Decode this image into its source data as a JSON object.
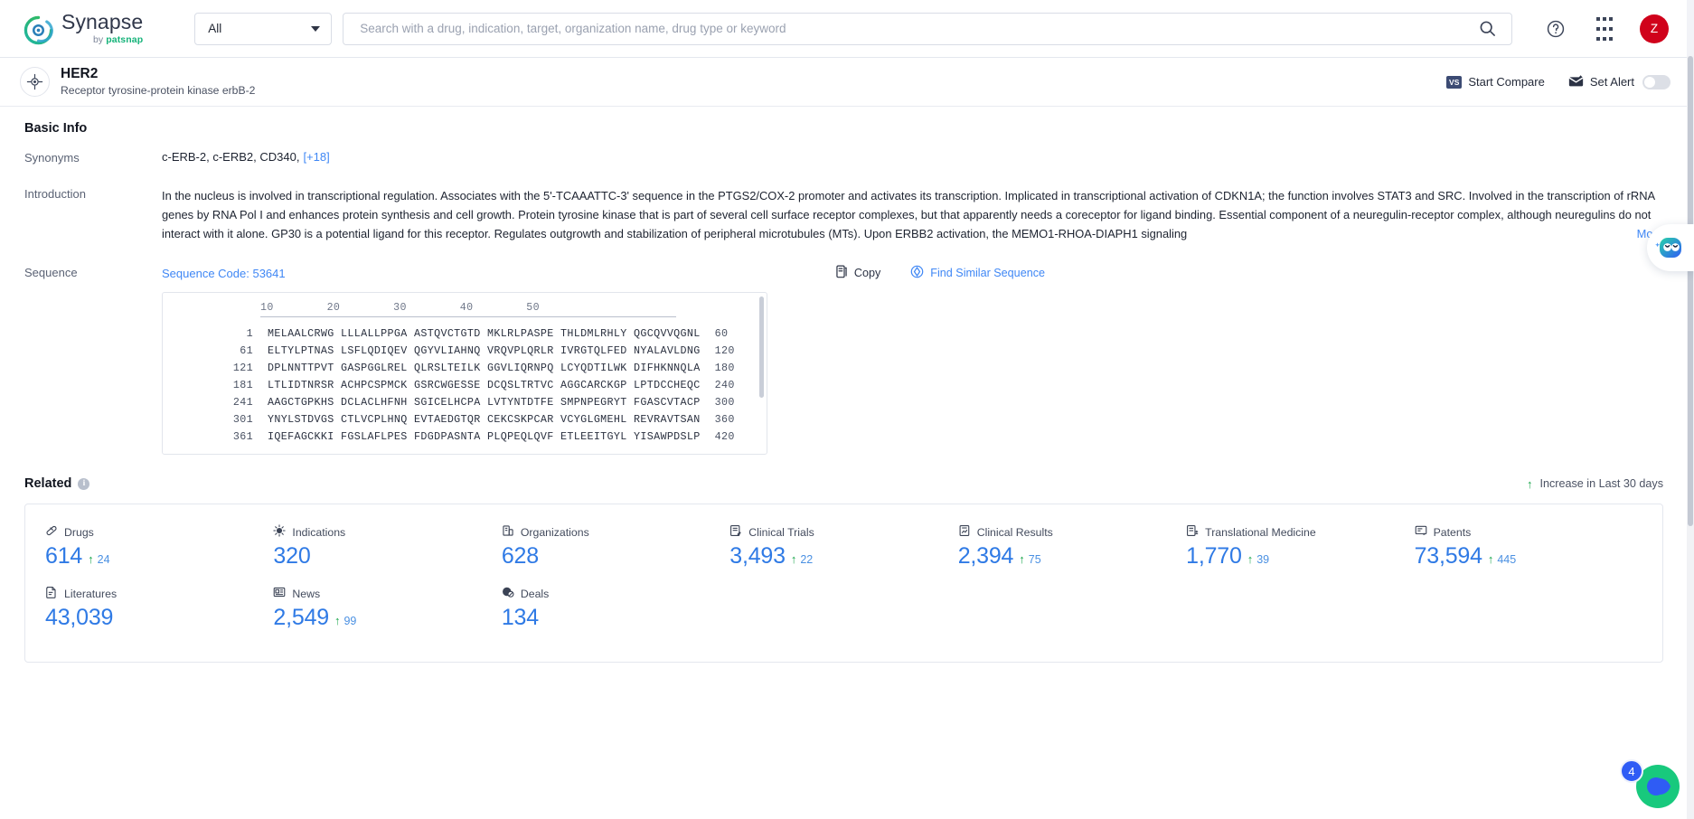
{
  "brand": {
    "name": "Synapse",
    "by": "by ",
    "by_brand": "patsnap",
    "logo_icon": "synapse-logo-icon"
  },
  "topbar": {
    "scope_selected": "All",
    "scope_caret_icon": "chevron-down-icon",
    "search_placeholder": "Search with a drug, indication, target, organization name, drug type or keyword",
    "search_value": "",
    "search_icon": "search-icon",
    "help_icon": "help-circle-icon",
    "apps_icon": "apps-grid-icon",
    "avatar_initial": "Z"
  },
  "entity": {
    "icon": "target-crosshair-icon",
    "name": "HER2",
    "description": "Receptor tyrosine-protein kinase erbB-2",
    "start_compare_label": "Start Compare",
    "start_compare_badge": "VS",
    "set_alert_label": "Set Alert",
    "set_alert_icon": "alert-envelope-icon",
    "set_alert_on": false
  },
  "basic_info": {
    "title": "Basic Info",
    "synonyms_label": "Synonyms",
    "synonyms_value": "c-ERB-2,  c-ERB2,  CD340,",
    "synonyms_more": "[+18]",
    "introduction_label": "Introduction",
    "introduction_text": "In the nucleus is involved in transcriptional regulation. Associates with the 5'-TCAAATTC-3' sequence in the PTGS2/COX-2 promoter and activates its transcription. Implicated in transcriptional activation of CDKN1A; the function involves STAT3 and SRC. Involved in the transcription of rRNA genes by RNA Pol I and enhances protein synthesis and cell growth. Protein tyrosine kinase that is part of several cell surface receptor complexes, but that apparently needs a coreceptor for ligand binding. Essential component of a neuregulin-receptor complex, although neuregulins do not interact with it alone. GP30 is a potential ligand for this receptor. Regulates outgrowth and stabilization of peripheral microtubules (MTs). Upon ERBB2 activation, the MEMO1-RHOA-DIAPH1 signaling",
    "introduction_more": "More",
    "sequence_label": "Sequence",
    "sequence_code": "Sequence Code: 53641",
    "copy_label": "Copy",
    "copy_icon": "copy-icon",
    "find_similar_label": "Find Similar Sequence",
    "find_similar_icon": "find-similar-sequence-icon",
    "sequence_ruler": "10        20        30        40        50",
    "sequence_rows": [
      {
        "start": "1",
        "letters": "MELAALCRWG LLLALLPPGA ASTQVCTGTD MKLRLPASPE THLDMLRHLY QGCQVVQGNL",
        "end": "60"
      },
      {
        "start": "61",
        "letters": "ELTYLPTNAS LSFLQDIQEV QGYVLIAHNQ VRQVPLQRLR IVRGTQLFED NYALAVLDNG",
        "end": "120"
      },
      {
        "start": "121",
        "letters": "DPLNNTTPVT GASPGGLREL QLRSLTEILK GGVLIQRNPQ LCYQDTILWK DIFHKNNQLA",
        "end": "180"
      },
      {
        "start": "181",
        "letters": "LTLIDTNRSR ACHPCSPMCK GSRCWGESSE DCQSLTRTVC AGGCARCKGP LPTDCCHEQC",
        "end": "240"
      },
      {
        "start": "241",
        "letters": "AAGCTGPKHS DCLACLHFNH SGICELHCPA LVTYNTDTFE SMPNPEGRYT FGASCVTACP",
        "end": "300"
      },
      {
        "start": "301",
        "letters": "YNYLSTDVGS CTLVCPLHNQ EVTAEDGTQR CEKCSKPCAR VCYGLGMEHL REVRAVTSAN",
        "end": "360"
      },
      {
        "start": "361",
        "letters": "IQEFAGCKKI FGSLAFLPES FDGDPASNTA PLQPEQLQVF ETLEEITGYL YISAWPDSLP",
        "end": "420"
      }
    ]
  },
  "related": {
    "title": "Related",
    "info_icon": "info-icon",
    "increase_note": "Increase in Last 30 days",
    "increase_arrow_icon": "arrow-up-icon",
    "stats": [
      {
        "icon": "capsule-icon",
        "label": "Drugs",
        "value": "614",
        "delta": "24"
      },
      {
        "icon": "virus-icon",
        "label": "Indications",
        "value": "320",
        "delta": ""
      },
      {
        "icon": "building-icon",
        "label": "Organizations",
        "value": "628",
        "delta": ""
      },
      {
        "icon": "clinical-trial-icon",
        "label": "Clinical Trials",
        "value": "3,493",
        "delta": "22"
      },
      {
        "icon": "clinical-result-icon",
        "label": "Clinical Results",
        "value": "2,394",
        "delta": "75"
      },
      {
        "icon": "translational-icon",
        "label": "Translational Medicine",
        "value": "1,770",
        "delta": "39"
      },
      {
        "icon": "patent-icon",
        "label": "Patents",
        "value": "73,594",
        "delta": "445"
      },
      {
        "icon": "literature-icon",
        "label": "Literatures",
        "value": "43,039",
        "delta": ""
      },
      {
        "icon": "news-icon",
        "label": "News",
        "value": "2,549",
        "delta": "99"
      },
      {
        "icon": "deal-icon",
        "label": "Deals",
        "value": "134",
        "delta": ""
      }
    ]
  },
  "floating": {
    "assistant_icon": "ai-assistant-icon",
    "chat_icon": "chat-bubble-icon",
    "chat_badge": "4"
  },
  "colors": {
    "accent_blue": "#2f7ae5",
    "link_blue": "#3f87f5",
    "increase_green": "#1aa64b",
    "avatar_red": "#d0021b"
  }
}
